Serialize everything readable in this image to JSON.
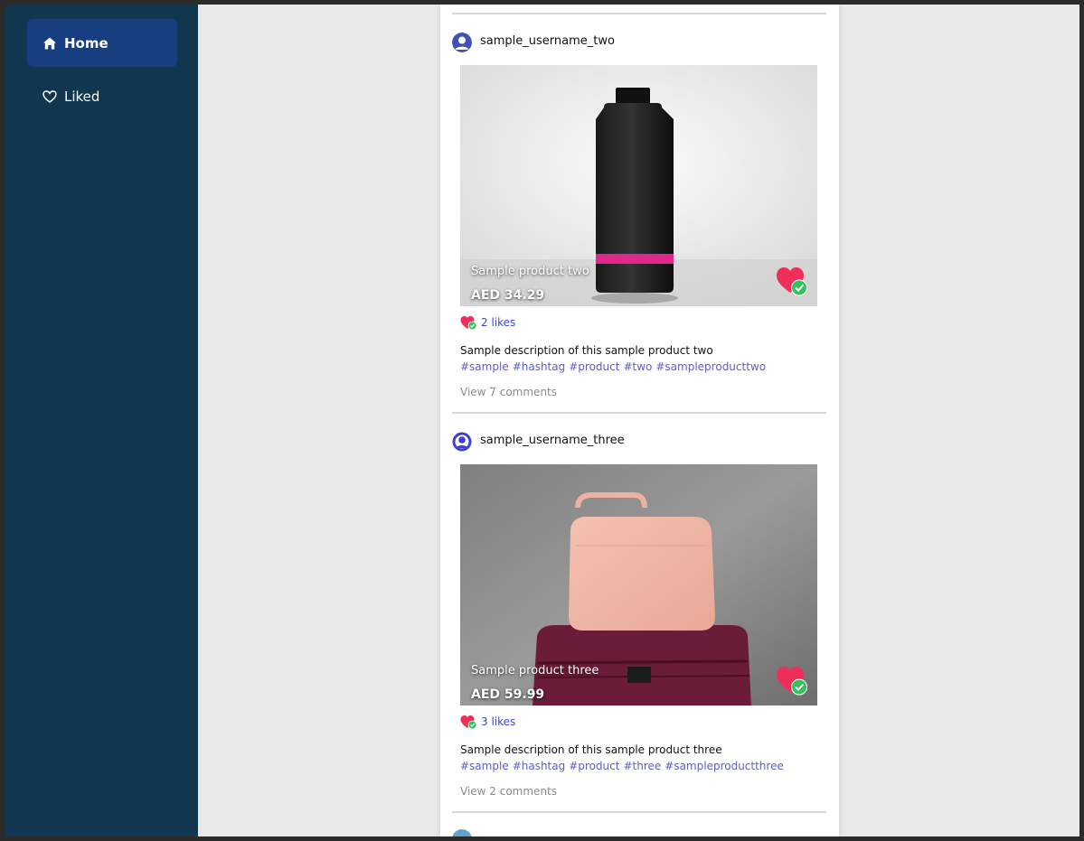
{
  "sidebar": {
    "items": [
      {
        "label": "Home",
        "icon": "home-icon",
        "active": true
      },
      {
        "label": "Liked",
        "icon": "heart-outline-icon",
        "active": false
      }
    ]
  },
  "colors": {
    "sidebar_bg": "#10374f",
    "active_item_bg": "#163e80",
    "like_heart": "#ef2f5a",
    "check_badge": "#34c15b",
    "hashtag": "#5a5fd0",
    "likes_link": "#3b49c7"
  },
  "posts": [
    {
      "username": "sample_username_two",
      "product_name": "Sample product two",
      "price": "AED 34.29",
      "likes": "2 likes",
      "description": "Sample description of this sample product two",
      "hashtags": [
        "#sample",
        "#hashtag",
        "#product",
        "#two",
        "#sampleproducttwo"
      ],
      "comments": "View 7 comments"
    },
    {
      "username": "sample_username_three",
      "product_name": "Sample product three",
      "price": "AED 59.99",
      "likes": "3 likes",
      "description": "Sample description of this sample product three",
      "hashtags": [
        "#sample",
        "#hashtag",
        "#product",
        "#three",
        "#sampleproductthree"
      ],
      "comments": "View 2 comments"
    }
  ]
}
